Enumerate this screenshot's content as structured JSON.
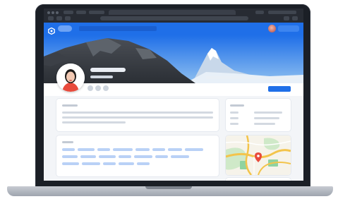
{
  "app": {
    "nav": {
      "logo_icon": "hexagon-logo-icon",
      "accent_color": "#1f6fe8"
    },
    "cover": {
      "description_icon": "mountain-landscape"
    },
    "colors": {
      "primary": "#1f6fe8",
      "background": "#f3f5f8",
      "card": "#ffffff",
      "map_green": "#8fd3a0",
      "map_road": "#f3c44b",
      "pin_red": "#e84a3c"
    }
  }
}
